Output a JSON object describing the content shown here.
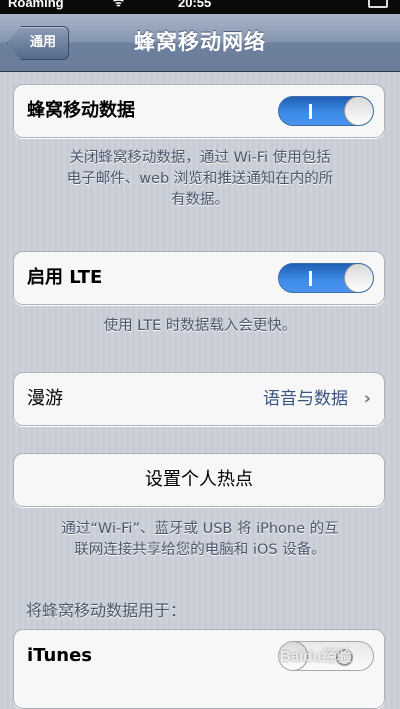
{
  "status_bar": {
    "carrier": "Roaming",
    "time": "20:55"
  },
  "nav": {
    "back_label": "通用",
    "title": "蜂窝移动网络"
  },
  "cellular_data": {
    "label": "蜂窝移动数据",
    "on": true,
    "footer_lines": [
      "关闭蜂窝移动数据，通过 Wi-Fi 使用包括",
      "电子邮件、web 浏览和推送通知在内的所",
      "有数据。"
    ]
  },
  "lte": {
    "label": "启用 LTE",
    "on": true,
    "footer": "使用 LTE 时数据载入会更快。"
  },
  "roaming": {
    "label": "漫游",
    "value": "语音与数据"
  },
  "hotspot": {
    "label": "设置个人热点",
    "footer_lines": [
      "通过“Wi-Fi”、蓝牙或 USB 将 iPhone 的互",
      "联网连接共享给您的电脑和 iOS 设备。"
    ]
  },
  "use_for": {
    "header": "将蜂窝移动数据用于：",
    "items": [
      {
        "label": "iTunes",
        "on": false
      }
    ]
  },
  "watermark": "Baidu经验",
  "colors": {
    "switch_on": "#3d8ae8",
    "value_text": "#395481",
    "footer_text": "#4c566c"
  }
}
